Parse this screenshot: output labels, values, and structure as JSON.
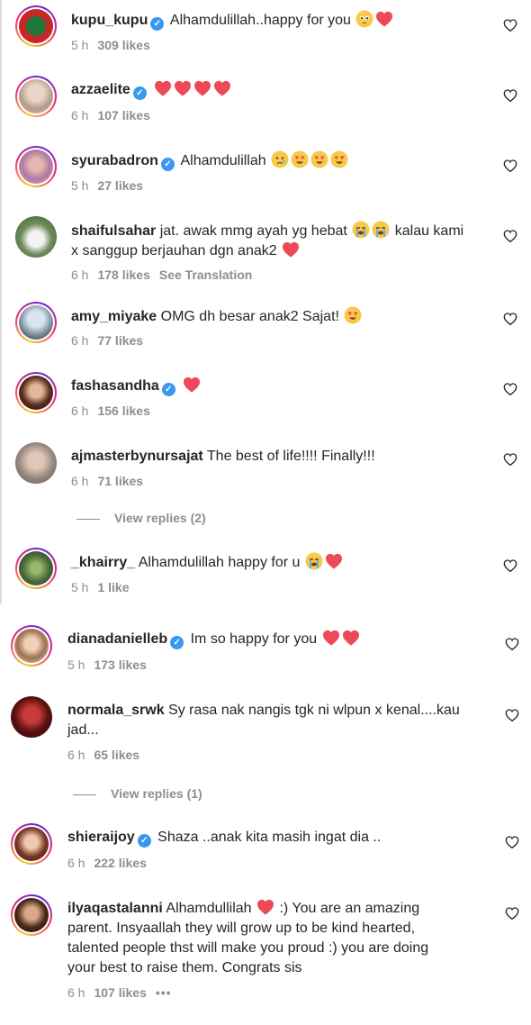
{
  "comments": [
    {
      "user": "kupu_kupu",
      "verified": true,
      "text": "Alhamdulillah..happy for you",
      "time": "5 h",
      "likes": "309 likes"
    },
    {
      "user": "azzaelite",
      "verified": true,
      "text": "",
      "time": "6 h",
      "likes": "107 likes"
    },
    {
      "user": "syurabadron",
      "verified": true,
      "text": "Alhamdulillah",
      "time": "5 h",
      "likes": "27 likes"
    },
    {
      "user": "shaifulsahar",
      "verified": false,
      "text": "jat. awak mmg ayah yg hebat",
      "text2": "kalau kami",
      "text3": "x sanggup berjauhan dgn anak2",
      "time": "6 h",
      "likes": "178 likes",
      "translate": "See Translation"
    },
    {
      "user": "amy_miyake",
      "verified": false,
      "text": "OMG dh besar anak2 Sajat!",
      "time": "6 h",
      "likes": "77 likes"
    },
    {
      "user": "fashasandha",
      "verified": true,
      "text": "",
      "time": "6 h",
      "likes": "156 likes"
    },
    {
      "user": "ajmasterbynursajat",
      "verified": false,
      "text": "The best of life!!!! Finally!!!",
      "time": "6 h",
      "likes": "71 likes",
      "replies": "View replies (2)"
    },
    {
      "user": "_khairry_",
      "verified": false,
      "text": "Alhamdulillah happy for u",
      "time": "5 h",
      "likes": "1 like"
    },
    {
      "user": "dianadanielleb",
      "verified": true,
      "text": "Im so happy for you",
      "time": "5 h",
      "likes": "173 likes"
    },
    {
      "user": "normala_srwk",
      "verified": false,
      "text": "Sy rasa nak nangis tgk ni wlpun x kenal....kau",
      "text2": "jad...",
      "time": "6 h",
      "likes": "65 likes",
      "replies": "View replies (1)"
    },
    {
      "user": "shieraijoy",
      "verified": true,
      "text": "Shaza ..anak kita masih ingat dia ..",
      "time": "6 h",
      "likes": "222 likes"
    },
    {
      "user": "ilyaqastalanni",
      "verified": false,
      "text": "Alhamdullilah",
      "text_after": ":) You are an amazing",
      "text2": "parent. Insyaallah they will grow up to be kind hearted,",
      "text3": "talented people thst will make you proud :) you are doing",
      "text4": "your best to raise them. Congrats sis",
      "time": "6 h",
      "likes": "107 likes",
      "more": "•••"
    }
  ],
  "colors": {
    "verified": "#3897f0",
    "heart": "#ed4956",
    "muted": "#8e8e8e"
  }
}
